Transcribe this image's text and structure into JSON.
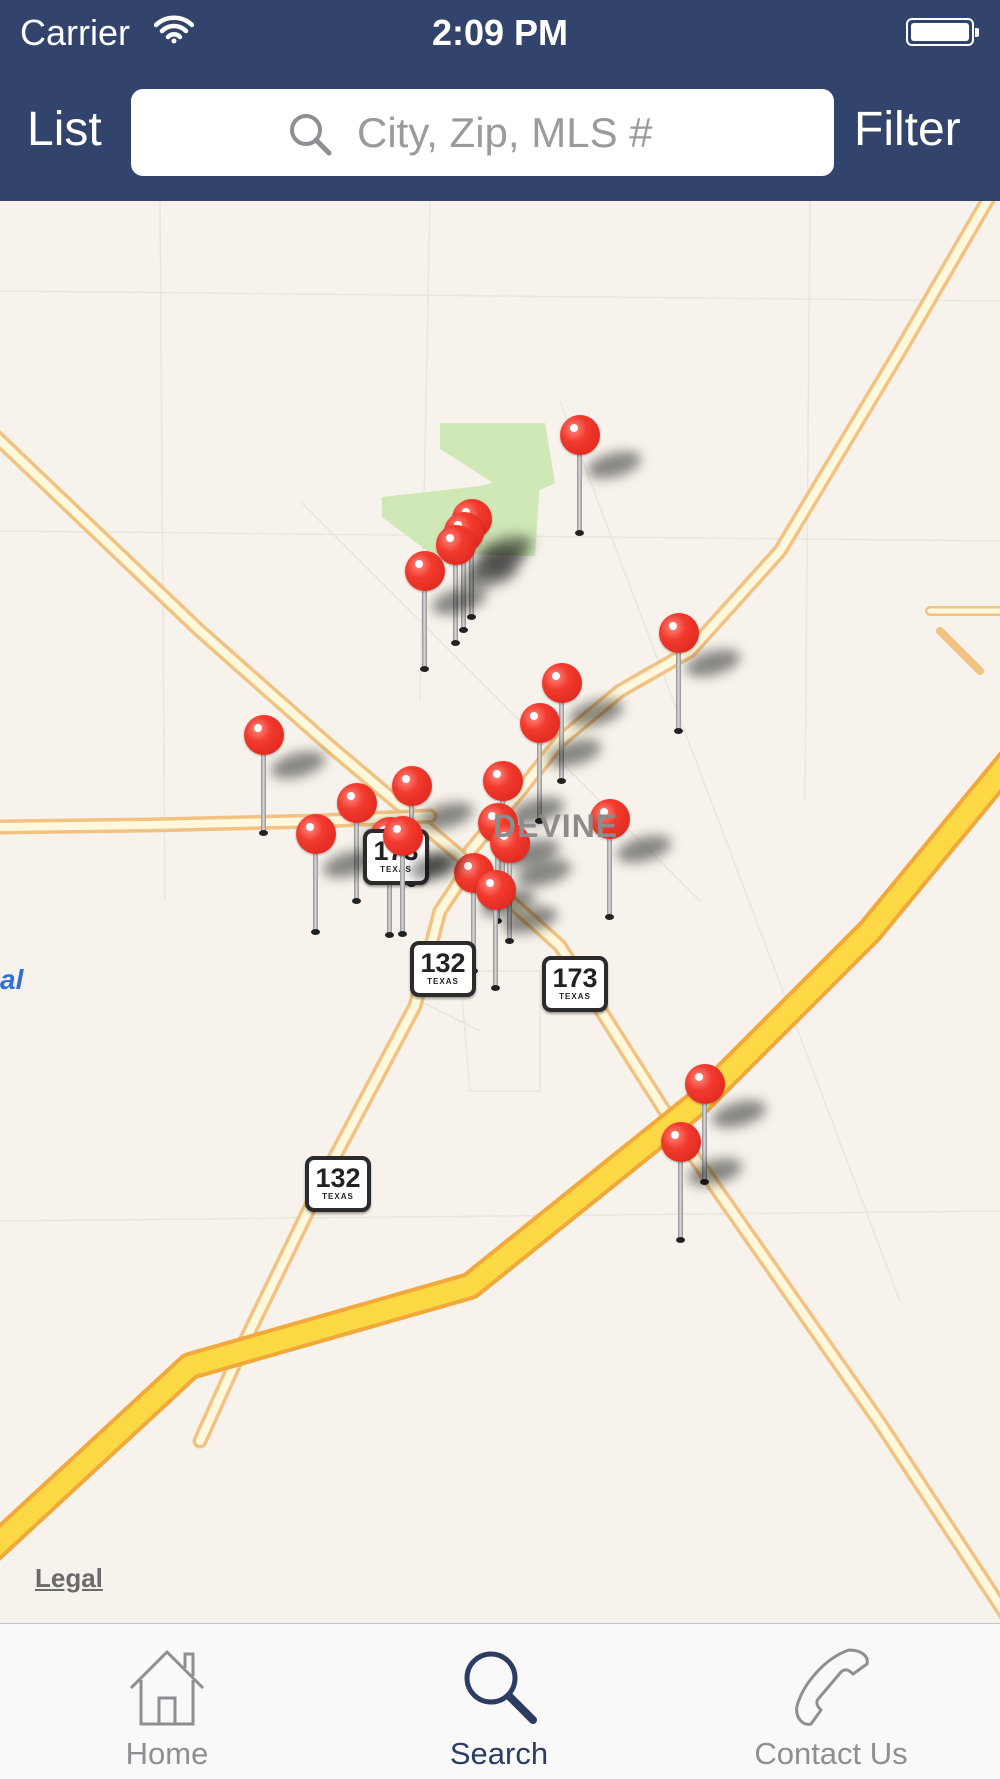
{
  "status_bar": {
    "carrier": "Carrier",
    "time": "2:09 PM",
    "wifi_icon": "wifi-icon",
    "battery_icon": "battery-icon"
  },
  "nav": {
    "list_label": "List",
    "filter_label": "Filter",
    "search_placeholder": "City, Zip, MLS #",
    "search_value": ""
  },
  "map": {
    "town_label": "DEVINE",
    "edge_label": "al",
    "legal": "Legal",
    "route_shields": [
      {
        "number": "173",
        "state": "TEXAS"
      },
      {
        "number": "132",
        "state": "TEXAS"
      },
      {
        "number": "173",
        "state": "TEXAS"
      },
      {
        "number": "132",
        "state": "TEXAS"
      }
    ],
    "listing_pin_count": 22
  },
  "tabs": [
    {
      "label": "Home",
      "icon": "house-icon",
      "active": false
    },
    {
      "label": "Search",
      "icon": "magnifier-icon",
      "active": true
    },
    {
      "label": "Contact Us",
      "icon": "phone-icon",
      "active": false
    }
  ],
  "colors": {
    "nav_bar": "#32446b",
    "pin": "#e8291f",
    "highway": "#fdd845",
    "road": "#f4c584",
    "park": "#cfe8b6",
    "tab_active": "#2b3d63",
    "tab_inactive": "#8e8e93"
  }
}
